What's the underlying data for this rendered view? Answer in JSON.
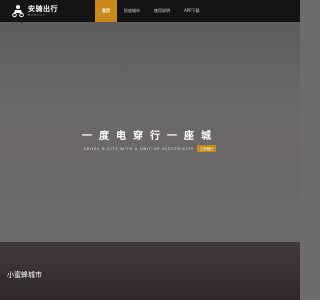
{
  "brand": {
    "title": "安骑出行",
    "subtitle": "BEEFLY",
    "icon": "scooter-rider-icon"
  },
  "nav": {
    "items": [
      {
        "label": "首页",
        "active": true
      },
      {
        "label": "投放城市",
        "active": false
      },
      {
        "label": "使用说明",
        "active": false
      },
      {
        "label": "APP下载",
        "active": false
      }
    ]
  },
  "hero": {
    "title": "一度电穿行一座城",
    "subtitle": "CROSS A CITY WITH A UNIT OF ELECTRICITY",
    "badge": "立即骑行"
  },
  "section": {
    "title": "小蜜蜂城市"
  },
  "colors": {
    "accent": "#c98a1b",
    "topbar": "#141414",
    "hero": "#6b686a",
    "section": "#3a3537"
  }
}
